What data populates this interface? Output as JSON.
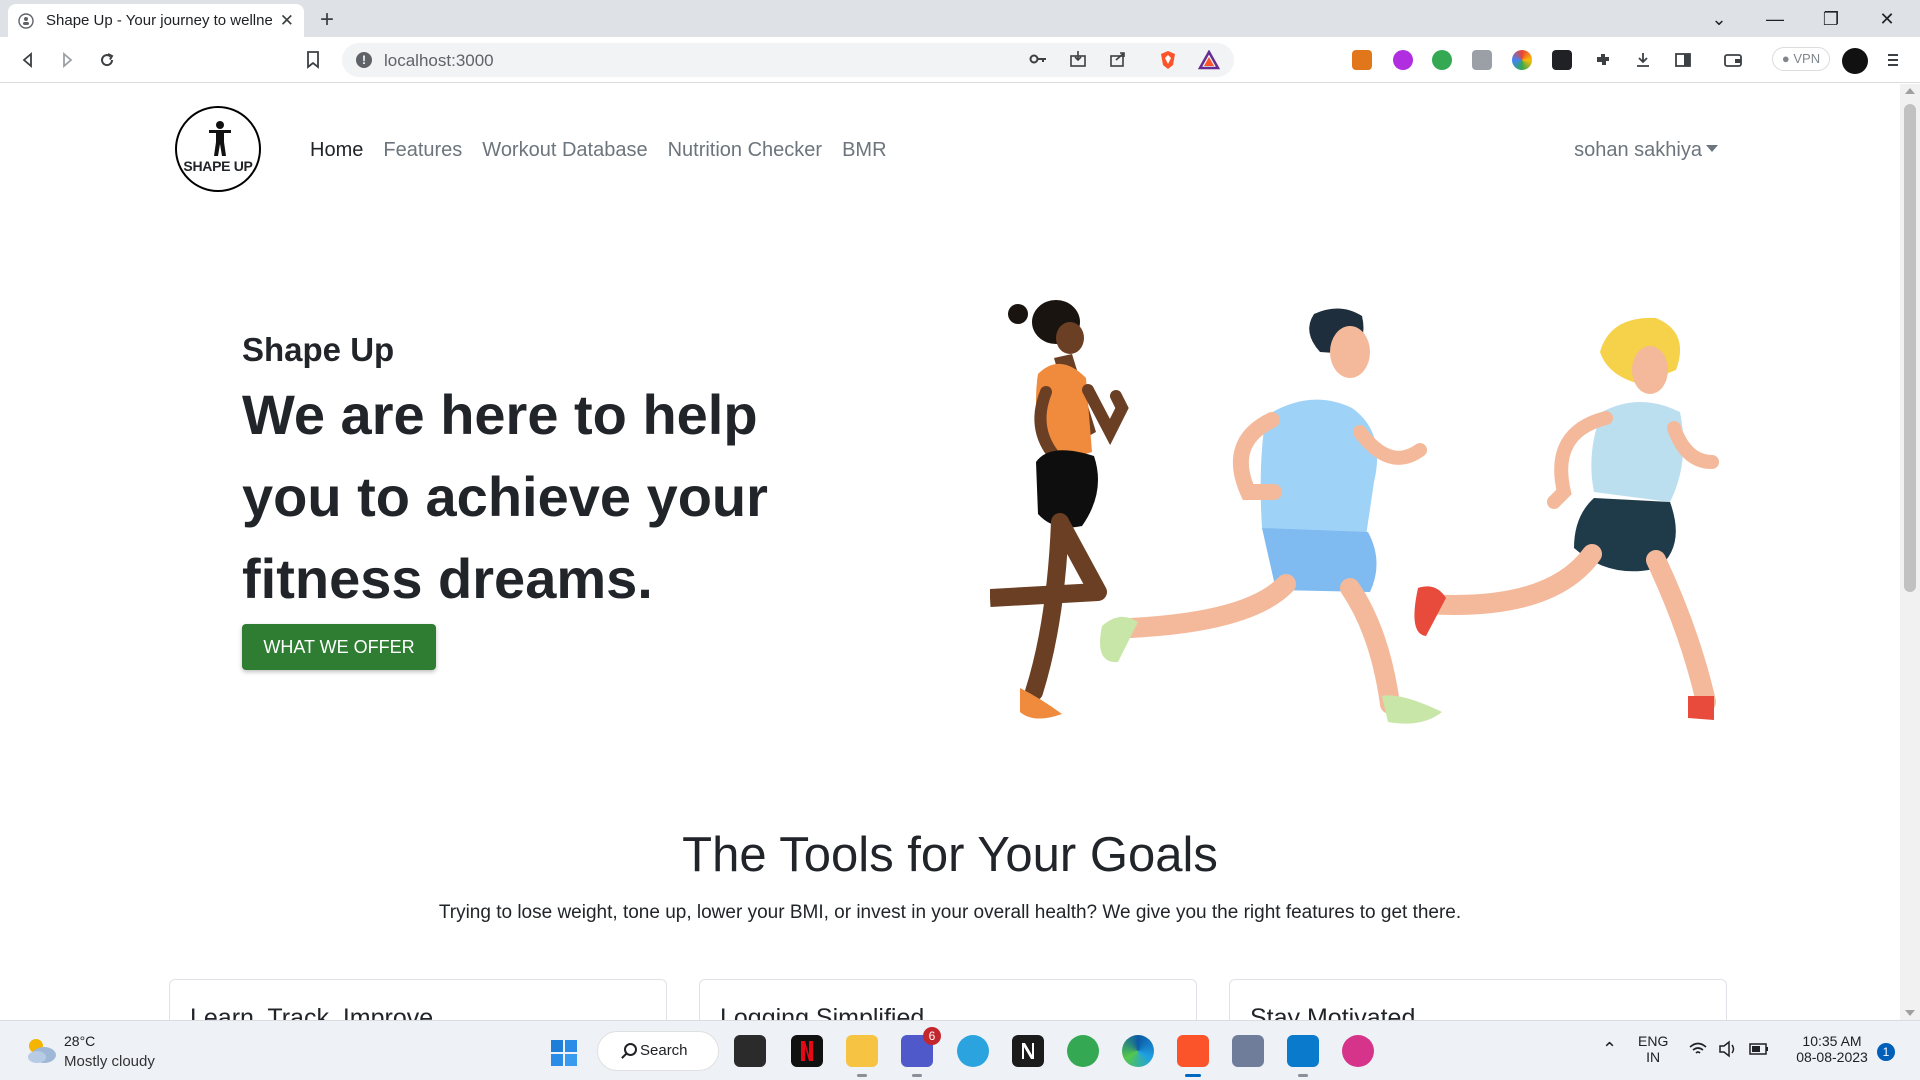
{
  "browser": {
    "tab_title": "Shape Up - Your journey to wellness",
    "tab_close": "✕",
    "new_tab": "+",
    "url": "localhost:3000",
    "vpn_label": "● VPN",
    "window_controls": {
      "menu": "⌄",
      "minimize": "—",
      "restore": "❐",
      "close": "✕"
    }
  },
  "site": {
    "logo_text": "SHAPE UP",
    "nav": [
      {
        "label": "Home",
        "active": true
      },
      {
        "label": "Features"
      },
      {
        "label": "Workout Database"
      },
      {
        "label": "Nutrition Checker"
      },
      {
        "label": "BMR"
      }
    ],
    "user_name": "sohan sakhiya",
    "hero": {
      "kicker": "Shape Up",
      "title": "We are here to help you to achieve your fitness dreams.",
      "cta": "WHAT WE OFFER"
    },
    "section": {
      "title": "The Tools for Your Goals",
      "subtitle": "Trying to lose weight, tone up, lower your BMI, or invest in your overall health? We give you the right features to get there."
    },
    "cards": [
      {
        "title": "Learn. Track. Improve."
      },
      {
        "title": "Logging Simplified"
      },
      {
        "title": "Stay Motivated"
      }
    ]
  },
  "taskbar": {
    "weather_temp": "28°C",
    "weather_desc": "Mostly cloudy",
    "search_label": "Search",
    "teams_badge": "6",
    "lang_line1": "ENG",
    "lang_line2": "IN",
    "time": "10:35 AM",
    "date": "08-08-2023",
    "notifications": "1"
  },
  "colors": {
    "cta": "#2e7d32",
    "nav_active": "#212529",
    "nav_inactive": "#6c757d"
  }
}
